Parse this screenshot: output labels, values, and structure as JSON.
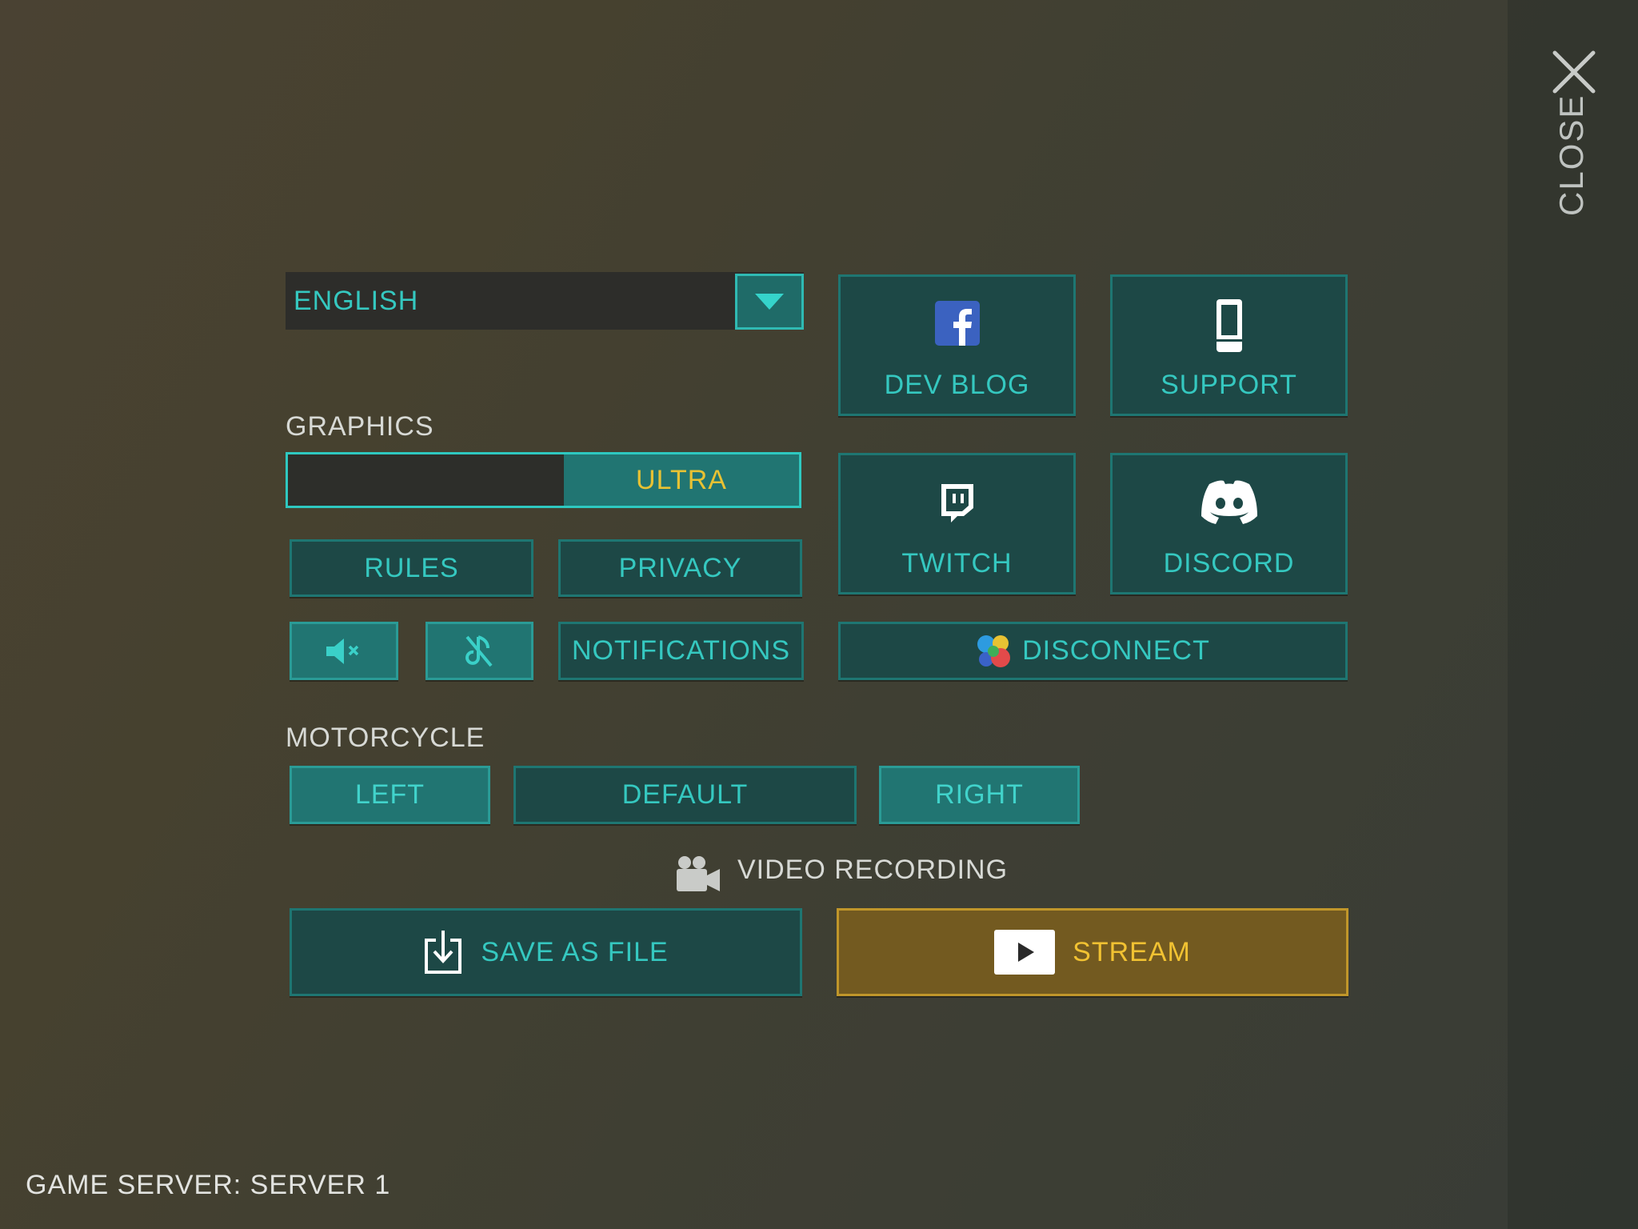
{
  "close": {
    "label": "CLOSE",
    "icon": "close-icon"
  },
  "language": {
    "selected": "ENGLISH",
    "icon": "chevron-down-icon"
  },
  "graphics": {
    "label": "GRAPHICS",
    "value": "ULTRA",
    "level": 0.46
  },
  "links": {
    "dev_blog": "DEV BLOG",
    "support": "SUPPORT",
    "twitch": "TWITCH",
    "discord": "DISCORD",
    "disconnect": "DISCONNECT"
  },
  "buttons": {
    "rules": "RULES",
    "privacy": "PRIVACY",
    "notifications": "NOTIFICATIONS",
    "sound_icon": "speaker-mute-icon",
    "music_icon": "music-off-icon"
  },
  "motorcycle": {
    "label": "MOTORCYCLE",
    "left": "LEFT",
    "default": "DEFAULT",
    "right": "RIGHT"
  },
  "video": {
    "label": "VIDEO RECORDING",
    "save": "SAVE AS FILE",
    "stream": "STREAM"
  },
  "footer": {
    "server": "GAME SERVER: SERVER 1"
  },
  "colors": {
    "accent": "#35c8c0",
    "button_bg": "#1d4846",
    "highlight": "#f1c232",
    "stream_bg": "#735a20"
  }
}
